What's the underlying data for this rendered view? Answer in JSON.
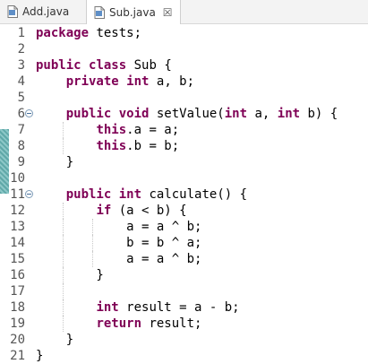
{
  "tabs": [
    {
      "label": "Add.java",
      "active": false
    },
    {
      "label": "Sub.java",
      "active": true
    }
  ],
  "editor": {
    "lines": [
      {
        "num": "1",
        "parts": [
          {
            "t": "package",
            "k": 1
          },
          {
            "t": " tests;"
          }
        ]
      },
      {
        "num": "2",
        "parts": []
      },
      {
        "num": "3",
        "parts": [
          {
            "t": "public",
            "k": 1
          },
          {
            "t": " "
          },
          {
            "t": "class",
            "k": 1
          },
          {
            "t": " Sub {"
          }
        ]
      },
      {
        "num": "4",
        "parts": [
          {
            "t": "    "
          },
          {
            "t": "private",
            "k": 1
          },
          {
            "t": " "
          },
          {
            "t": "int",
            "k": 1
          },
          {
            "t": " a, b;"
          }
        ]
      },
      {
        "num": "5",
        "parts": []
      },
      {
        "num": "6",
        "fold": true,
        "parts": [
          {
            "t": "    "
          },
          {
            "t": "public",
            "k": 1
          },
          {
            "t": " "
          },
          {
            "t": "void",
            "k": 1
          },
          {
            "t": " setValue("
          },
          {
            "t": "int",
            "k": 1
          },
          {
            "t": " a, "
          },
          {
            "t": "int",
            "k": 1
          },
          {
            "t": " b) {"
          }
        ]
      },
      {
        "num": "7",
        "parts": [
          {
            "t": "        "
          },
          {
            "t": "this",
            "k": 1
          },
          {
            "t": ".a = a;"
          }
        ]
      },
      {
        "num": "8",
        "parts": [
          {
            "t": "        "
          },
          {
            "t": "this",
            "k": 1
          },
          {
            "t": ".b = b;"
          }
        ]
      },
      {
        "num": "9",
        "parts": [
          {
            "t": "    }"
          }
        ]
      },
      {
        "num": "10",
        "parts": []
      },
      {
        "num": "11",
        "fold": true,
        "parts": [
          {
            "t": "    "
          },
          {
            "t": "public",
            "k": 1
          },
          {
            "t": " "
          },
          {
            "t": "int",
            "k": 1
          },
          {
            "t": " calculate() {"
          }
        ]
      },
      {
        "num": "12",
        "parts": [
          {
            "t": "        "
          },
          {
            "t": "if",
            "k": 1
          },
          {
            "t": " (a < b) {"
          }
        ]
      },
      {
        "num": "13",
        "parts": [
          {
            "t": "            a = a ^ b;"
          }
        ]
      },
      {
        "num": "14",
        "parts": [
          {
            "t": "            b = b ^ a;"
          }
        ]
      },
      {
        "num": "15",
        "parts": [
          {
            "t": "            a = a ^ b;"
          }
        ]
      },
      {
        "num": "16",
        "parts": [
          {
            "t": "        }"
          }
        ]
      },
      {
        "num": "17",
        "parts": []
      },
      {
        "num": "18",
        "parts": [
          {
            "t": "        "
          },
          {
            "t": "int",
            "k": 1
          },
          {
            "t": " result = a - b;"
          }
        ]
      },
      {
        "num": "19",
        "parts": [
          {
            "t": "        "
          },
          {
            "t": "return",
            "k": 1
          },
          {
            "t": " result;"
          }
        ]
      },
      {
        "num": "20",
        "parts": [
          {
            "t": "    }"
          }
        ]
      },
      {
        "num": "21",
        "parts": [
          {
            "t": "}"
          }
        ]
      }
    ]
  },
  "colors": {
    "keyword": "#7f0055",
    "change_bar": "#5fa8a8",
    "line_number": "#555555"
  }
}
